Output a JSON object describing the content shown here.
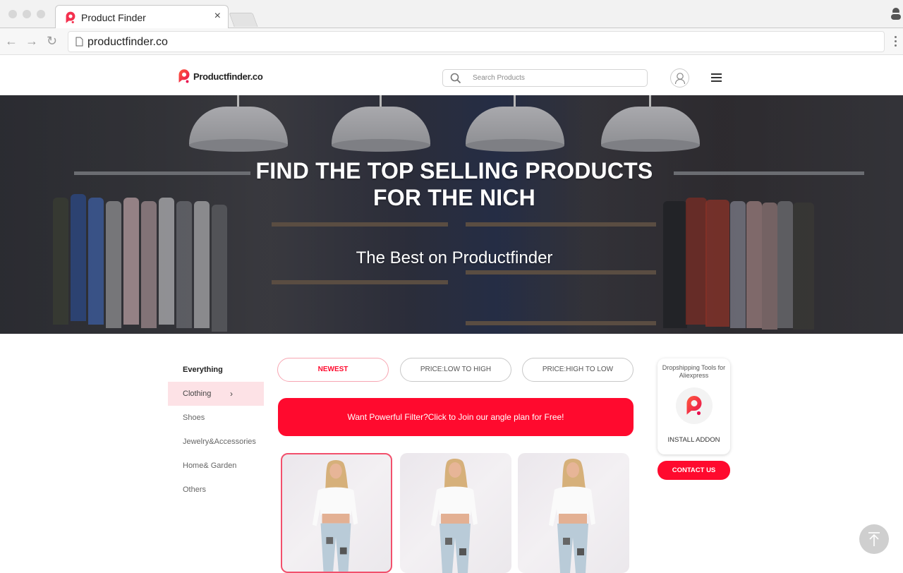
{
  "browser": {
    "tab_title": "Product Finder",
    "tab_close": "×",
    "url": "productfinder.co",
    "nav": {
      "back": "←",
      "forward": "→",
      "reload": "↻"
    }
  },
  "header": {
    "logo_text": "Productfinder.co",
    "search_placeholder": "Search Products",
    "search_value": ""
  },
  "hero": {
    "title_line1": "FIND THE TOP SELLING PRODUCTS",
    "title_line2": "FOR THE NICH",
    "subtitle": "The Best on Productfinder"
  },
  "categories": {
    "heading": "Everything",
    "items": [
      {
        "label": "Clothing",
        "active": true,
        "chevron": "›"
      },
      {
        "label": "Shoes"
      },
      {
        "label": "Jewelry&Accessories"
      },
      {
        "label": "Home& Garden"
      },
      {
        "label": "Others"
      }
    ]
  },
  "sort": {
    "options": [
      {
        "label": "NEWEST",
        "active": true
      },
      {
        "label": "PRICE:LOW TO HIGH"
      },
      {
        "label": "PRICE:HIGH TO LOW"
      }
    ]
  },
  "promo": {
    "label": "Want Powerful Filter?Click to Join our angle plan for Free!"
  },
  "products": [
    {
      "selected": true
    },
    {
      "selected": false
    },
    {
      "selected": false
    }
  ],
  "addon": {
    "title": "Dropshipping Tools for Aliexpress",
    "install_label": "INSTALL ADDON",
    "contact_label": "CONTACT US"
  },
  "colors": {
    "brand_red": "#ff0a2e",
    "active_category_bg": "#fde2e6",
    "scroll_top_bg": "#cfcfcf"
  },
  "icons": {
    "favicon": "productfinder-logo-icon",
    "search": "search-icon",
    "user": "user-icon",
    "menu": "hamburger-menu-icon",
    "scroll_top": "arrow-up-to-top-icon"
  }
}
